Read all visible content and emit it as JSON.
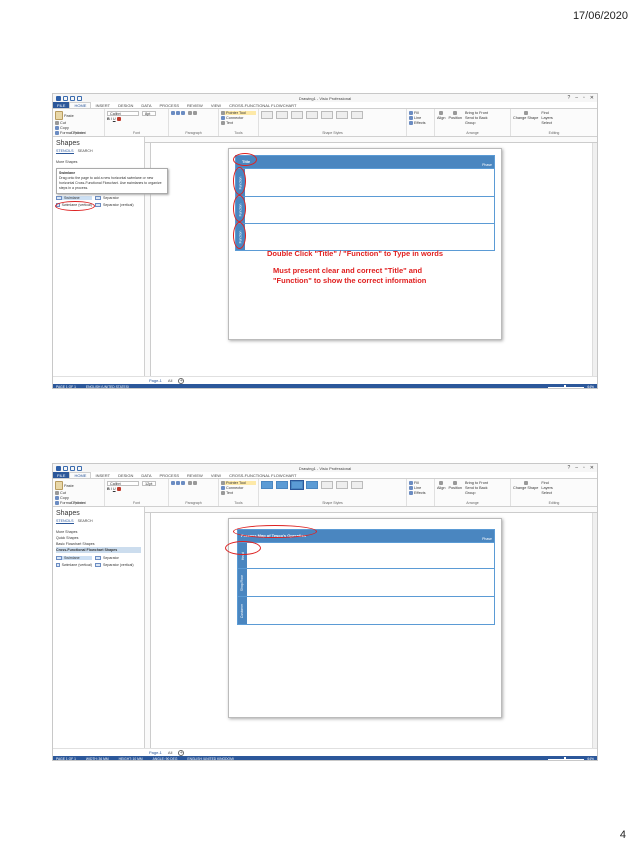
{
  "header": {
    "date": "17/06/2020"
  },
  "footer": {
    "page_number": "4"
  },
  "common": {
    "window_title": "Drawing1 - Visio Professional",
    "tabs": [
      "FILE",
      "HOME",
      "INSERT",
      "DESIGN",
      "DATA",
      "PROCESS",
      "REVIEW",
      "VIEW",
      "CROSS-FUNCTIONAL FLOWCHART"
    ],
    "ribbon": {
      "paste": "Paste",
      "cut": "Cut",
      "copy": "Copy",
      "format_painter": "Format Painter",
      "font_name": "Calibri",
      "pointer_tool": "Pointer Tool",
      "connector": "Connector",
      "text": "Text",
      "fill": "Fill",
      "line": "Line",
      "effects": "Effects",
      "align": "Align",
      "position": "Position",
      "bring_to_front": "Bring to Front",
      "send_to_back": "Send to Back",
      "group": "Group",
      "change_shape": "Change Shape",
      "find": "Find",
      "layers": "Layers",
      "select": "Select",
      "groups": [
        "Clipboard",
        "Font",
        "Paragraph",
        "Tools",
        "Shape Styles",
        "Arrange",
        "Editing"
      ]
    },
    "pane": {
      "title": "Shapes",
      "stencils_tab": "STENCILS",
      "search_tab": "SEARCH",
      "more_shapes": "More Shapes"
    },
    "stencil": {
      "swimlane": "Swimlane",
      "separator": "Separator",
      "swimlane_vertical": "Swimlane (vertical)",
      "separator_vertical": "Separator (vertical)"
    },
    "page_tab": "Page-1",
    "all_tab": "All"
  },
  "shot1": {
    "font_size": "8pt",
    "tooltip_title": "Swimlane",
    "tooltip_text": "Drag onto the page to add a new horizontal swimlane or new horizontal Cross-Functional Flowchart. Use swimlanes to organize steps in a process.",
    "diagram_title": "Title",
    "phase": "Phase",
    "lanes": [
      "Function",
      "Function",
      "Function"
    ],
    "instruction_1": "Double Click \"Title\" / \"Function\" to Type in words",
    "instruction_2": "Must present clear and correct \"Title\" and \"Function\" to show the correct information",
    "status_page": "PAGE 1 OF 1",
    "status_lang": "ENGLISH (UNITED STATES)",
    "zoom": "64%"
  },
  "shot2": {
    "font_size": "12pt",
    "pane_items": [
      "Quick Shapes",
      "Basic Flowchart Shapes",
      "Cross-Functional Flowchart Shapes"
    ],
    "diagram_title": "Process Map of Tesco's Operation",
    "phase": "Phase",
    "lanes": [
      "Head",
      "Shop Floor",
      "Customer"
    ],
    "status_page": "PAGE 1 OF 1",
    "status_width": "WIDTH: 36 MM",
    "status_height": "HEIGHT: 10 MM",
    "status_angle": "ANGLE: 90 DEG",
    "status_lang": "ENGLISH (UNITED KINGDOM)",
    "zoom": "64%"
  }
}
